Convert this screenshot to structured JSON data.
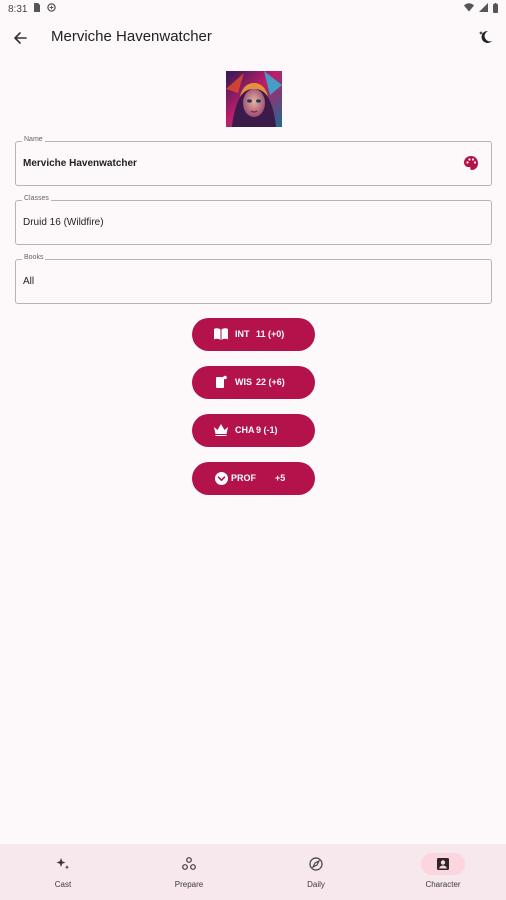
{
  "status": {
    "time": "8:31"
  },
  "app_bar": {
    "title": "Merviche Havenwatcher"
  },
  "form": {
    "name": {
      "label": "Name",
      "value": "Merviche Havenwatcher"
    },
    "classes": {
      "label": "Classes",
      "value": "Druid 16 (Wildfire)"
    },
    "books": {
      "label": "Books",
      "value": "All"
    }
  },
  "stats": [
    {
      "abbr": "INT",
      "value": "11 (+0)",
      "icon": "book-icon"
    },
    {
      "abbr": "WIS",
      "value": "22 (+6)",
      "icon": "scroll-icon"
    },
    {
      "abbr": "CHA",
      "value": "9 (-1)",
      "icon": "crown-icon"
    },
    {
      "abbr": "PROF",
      "value": "+5",
      "icon": "shield-chevron-icon"
    }
  ],
  "nav": [
    {
      "label": "Cast",
      "icon": "sparkle-icon",
      "active": false
    },
    {
      "label": "Prepare",
      "icon": "circles-icon",
      "active": false
    },
    {
      "label": "Daily",
      "icon": "compass-icon",
      "active": false
    },
    {
      "label": "Character",
      "icon": "person-badge-icon",
      "active": true
    }
  ],
  "colors": {
    "accent": "#b3124a",
    "background": "#fdf8fa",
    "nav_bg": "#f6e8ec",
    "nav_active": "#fbd6de"
  }
}
